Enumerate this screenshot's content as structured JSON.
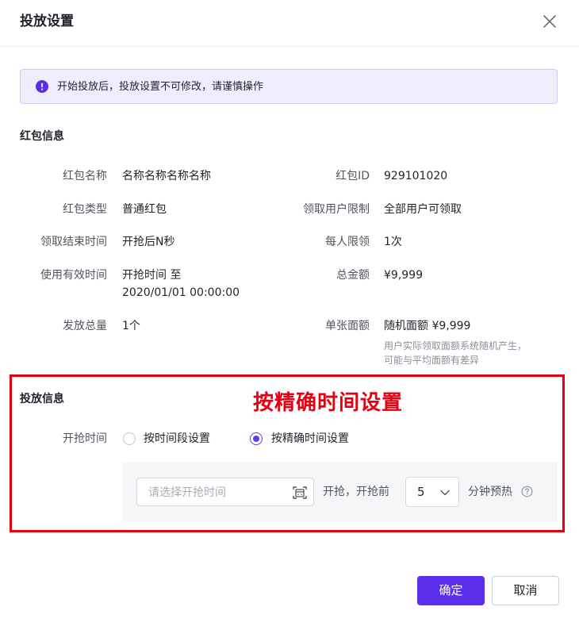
{
  "dialog": {
    "title": "投放设置",
    "alert": "开始投放后，投放设置不可修改，请谨慎操作"
  },
  "redpacket_info": {
    "section_title": "红包信息",
    "fields": [
      {
        "label": "红包名称",
        "value": "名称名称名称名称"
      },
      {
        "label": "红包ID",
        "value": "929101020"
      },
      {
        "label": "红包类型",
        "value": "普通红包"
      },
      {
        "label": "领取用户限制",
        "value": "全部用户可领取"
      },
      {
        "label": "领取结束时间",
        "value": "开抢后N秒"
      },
      {
        "label": "每人限领",
        "value": "1次"
      },
      {
        "label": "使用有效时间",
        "value_line1": "开抢时间 至",
        "value_line2": "2020/01/01 00:00:00"
      },
      {
        "label": "总金额",
        "value": "¥9,999"
      },
      {
        "label": "发放总量",
        "value": "1个"
      },
      {
        "label": "单张面额",
        "value": "随机面额 ¥9,999",
        "hint_line1": "用户实际领取面额系统随机产生，",
        "hint_line2": "可能与平均面额有差异"
      }
    ]
  },
  "delivery_info": {
    "section_title": "投放信息",
    "annotation": "按精确时间设置",
    "start_time_label": "开抢时间",
    "options": [
      {
        "label": "按时间段设置",
        "selected": false
      },
      {
        "label": "按精确时间设置",
        "selected": true
      }
    ],
    "date_placeholder": "请选择开抢时间",
    "text_before_select": "开抢，开抢前",
    "preheat_minutes": "5",
    "text_after_select": "分钟预热"
  },
  "footer": {
    "confirm_label": "确定",
    "cancel_label": "取消"
  },
  "colors": {
    "primary": "#5b2ee9",
    "annotation_red": "#e60012",
    "alert_bg": "#efeefd"
  }
}
